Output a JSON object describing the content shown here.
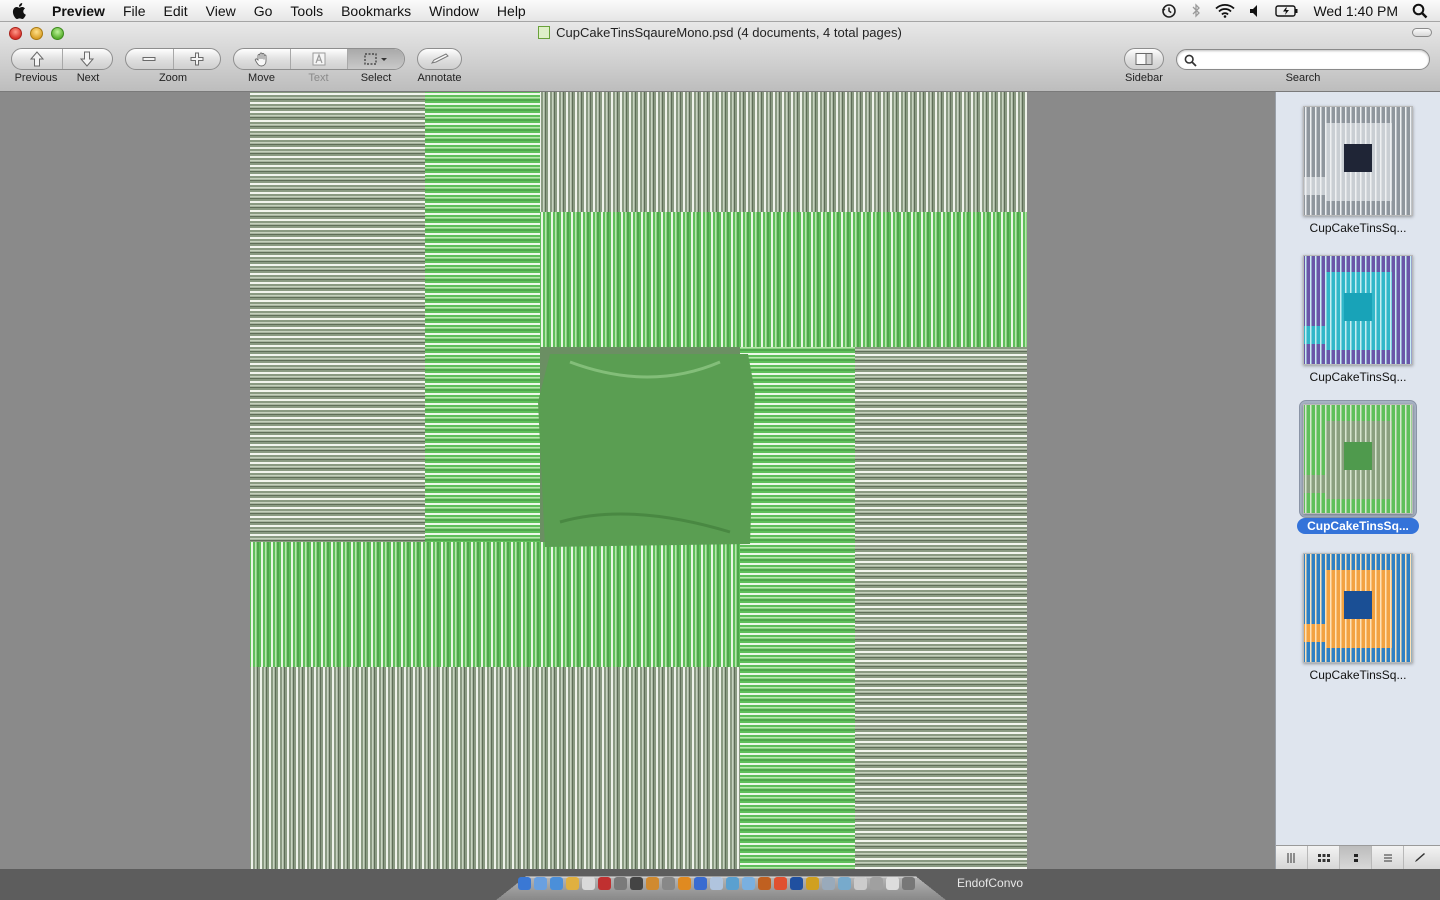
{
  "menubar": {
    "app_name": "Preview",
    "items": [
      "File",
      "Edit",
      "View",
      "Go",
      "Tools",
      "Bookmarks",
      "Window",
      "Help"
    ],
    "clock": "Wed 1:40 PM",
    "status_icons": [
      "time-machine-icon",
      "bluetooth-icon",
      "wifi-icon",
      "volume-icon",
      "battery-icon",
      "spotlight-icon"
    ]
  },
  "window": {
    "title": "CupCakeTinsSqaureMono.psd (4 documents, 4 total pages)"
  },
  "toolbar": {
    "previous_label": "Previous",
    "next_label": "Next",
    "zoom_label": "Zoom",
    "move_label": "Move",
    "text_label": "Text",
    "select_label": "Select",
    "annotate_label": "Annotate",
    "sidebar_label": "Sidebar",
    "search_label": "Search",
    "search_value": ""
  },
  "thumbnails": [
    {
      "label": "CupCakeTinsSq...",
      "selected": false,
      "palette": [
        "#c9ced3",
        "#8f969d",
        "#eef0f2",
        "#1f2536"
      ]
    },
    {
      "label": "CupCakeTinsSq...",
      "selected": false,
      "palette": [
        "#32b7c9",
        "#6a56a8",
        "#c7eef2",
        "#18a3b8"
      ]
    },
    {
      "label": "CupCakeTinsSq...",
      "selected": true,
      "palette": [
        "#8aa07f",
        "#5fbf5a",
        "#d8e6d0",
        "#4f9a4d"
      ]
    },
    {
      "label": "CupCakeTinsSq...",
      "selected": false,
      "palette": [
        "#f3a240",
        "#2e80c4",
        "#fde2b8",
        "#1a4f95"
      ]
    }
  ],
  "dock": {
    "label": "EndofConvo"
  },
  "colors": {
    "selection_blue": "#3473d9",
    "sidebar_bg": "#dfe5ee",
    "image_green": "#5fbf5a",
    "image_gray": "#8a9a82"
  }
}
